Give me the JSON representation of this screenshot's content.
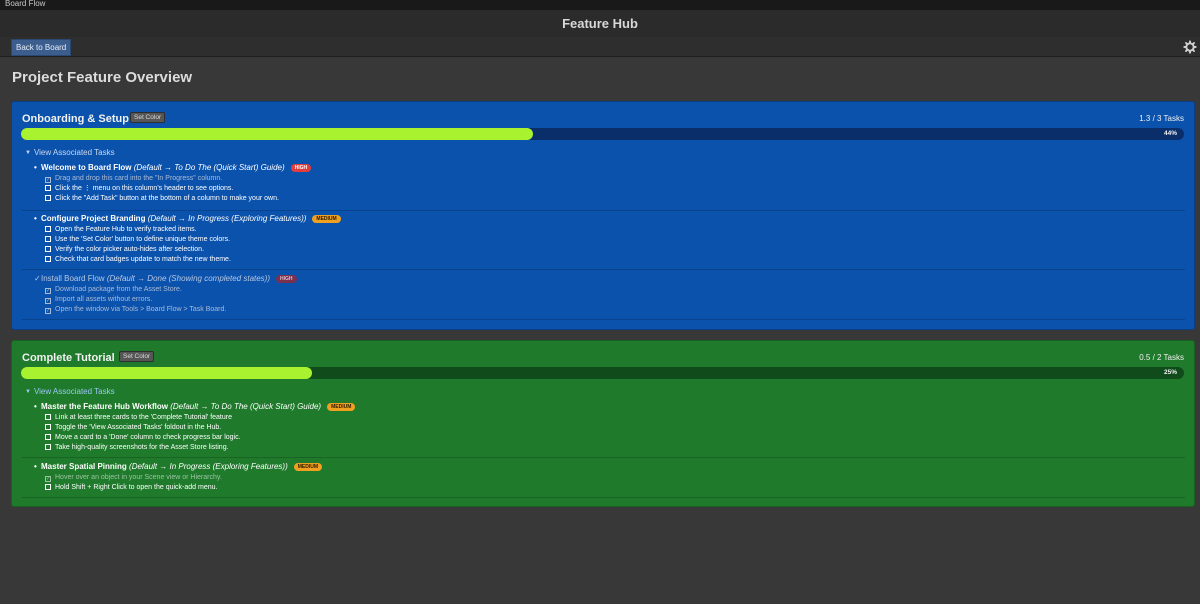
{
  "window": {
    "title": "Board Flow"
  },
  "header": {
    "title": "Feature Hub"
  },
  "toolbar": {
    "back_label": "Back to Board"
  },
  "page": {
    "title": "Project Feature Overview"
  },
  "colors": {
    "background": "#383838",
    "accent_blue": "#3c5e8f",
    "progress_fill": "#a8f22f",
    "high_badge": "#e03d3d",
    "medium_badge": "#f0a020"
  },
  "features": [
    {
      "title": "Onboarding & Setup",
      "color": "#0b52ad",
      "set_color_label": "Set Color",
      "task_count": "1.3 / 3 Tasks",
      "progress": 0.44,
      "progress_label": "44%",
      "foldout_label": "View Associated Tasks",
      "tasks": [
        {
          "bullet": "•",
          "name": "Welcome to Board Flow",
          "path": "(Default → To Do The (Quick Start) Guide)",
          "priority": "HIGH",
          "done": false,
          "subtasks": [
            {
              "text": "Drag and drop this card into the \"In Progress\" column.",
              "checked": true
            },
            {
              "text": "Click the ⋮ menu on this column's header to see options.",
              "checked": false
            },
            {
              "text": "Click the \"Add Task\" button at the bottom of a column to make your own.",
              "checked": false
            }
          ]
        },
        {
          "bullet": "•",
          "name": "Configure Project Branding",
          "path": "(Default → In Progress (Exploring Features))",
          "priority": "MEDIUM",
          "done": false,
          "subtasks": [
            {
              "text": "Open the Feature Hub to verify tracked items.",
              "checked": false
            },
            {
              "text": "Use the 'Set Color' button to define unique theme colors.",
              "checked": false
            },
            {
              "text": "Verify the color picker auto-hides after selection.",
              "checked": false
            },
            {
              "text": "Check that card badges update to match the new theme.",
              "checked": false
            }
          ]
        },
        {
          "bullet": "✓",
          "name": "Install Board Flow",
          "path": "(Default → Done (Showing completed states))",
          "priority": "HIGH",
          "done": true,
          "subtasks": [
            {
              "text": "Download package from the Asset Store.",
              "checked": true
            },
            {
              "text": "Import all assets without errors.",
              "checked": true
            },
            {
              "text": "Open the window via Tools > Board Flow > Task Board.",
              "checked": true
            }
          ]
        }
      ]
    },
    {
      "title": "Complete Tutorial",
      "color": "#1f7a2b",
      "set_color_label": "Set Color",
      "task_count": "0.5 / 2 Tasks",
      "progress": 0.25,
      "progress_label": "25%",
      "foldout_label": "View Associated Tasks",
      "tasks": [
        {
          "bullet": "•",
          "name": "Master the Feature Hub Workflow",
          "path": "(Default → To Do The (Quick Start) Guide)",
          "priority": "MEDIUM",
          "done": false,
          "subtasks": [
            {
              "text": "Link at least three cards to the 'Complete Tutorial' feature",
              "checked": false
            },
            {
              "text": "Toggle the 'View Associated Tasks' foldout in the Hub.",
              "checked": false
            },
            {
              "text": "Move a card to a 'Done' column to check progress bar logic.",
              "checked": false
            },
            {
              "text": "Take high-quality screenshots for the Asset Store listing.",
              "checked": false
            }
          ]
        },
        {
          "bullet": "•",
          "name": "Master Spatial Pinning",
          "path": "(Default → In Progress (Exploring Features))",
          "priority": "MEDIUM",
          "done": false,
          "subtasks": [
            {
              "text": "Hover over an object in your Scene view or Hierarchy.",
              "checked": true
            },
            {
              "text": "Hold Shift + Right Click to open the quick-add menu.",
              "checked": false
            }
          ]
        }
      ]
    }
  ]
}
